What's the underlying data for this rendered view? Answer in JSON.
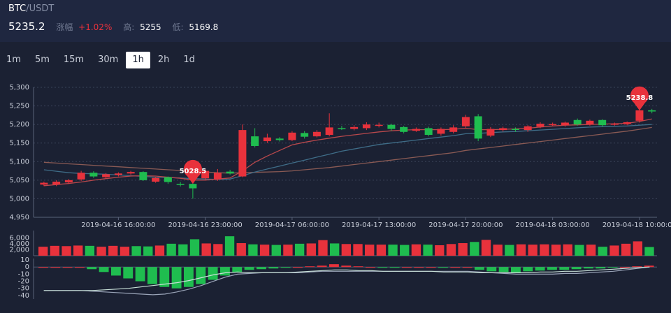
{
  "header": {
    "base": "BTC",
    "quote": "/USDT",
    "price": "5235.2",
    "change_label": "涨幅",
    "change_value": "+1.02%",
    "high_label": "高:",
    "high_value": "5255",
    "low_label": "低:",
    "low_value": "5169.8"
  },
  "tabs": [
    {
      "label": "1m",
      "active": false
    },
    {
      "label": "5m",
      "active": false
    },
    {
      "label": "15m",
      "active": false
    },
    {
      "label": "30m",
      "active": false
    },
    {
      "label": "1h",
      "active": true
    },
    {
      "label": "2h",
      "active": false
    },
    {
      "label": "1d",
      "active": false
    }
  ],
  "colors": {
    "up": "#e8323c",
    "down": "#1fbd4f",
    "ma1": "#b8484c",
    "ma2": "#3f6d88",
    "ma3": "#8a5a54",
    "grid": "#3a4258"
  },
  "chart_data": [
    {
      "type": "candlestick",
      "y_ticks": [
        "5,300",
        "5,250",
        "5,200",
        "5,150",
        "5,100",
        "5,050",
        "5,000",
        "4,950"
      ],
      "ylim": [
        4950,
        5300
      ],
      "x_ticks": [
        "2019-04-16 16:00:00",
        "2019-04-16 23:00:00",
        "2019-04-17 06:00:00",
        "2019-04-17 13:00:00",
        "2019-04-17 20:00:00",
        "2019-04-18 03:00:00",
        "2019-04-18 10:00:00"
      ],
      "x_tick_index": [
        6,
        13,
        20,
        27,
        34,
        41,
        48
      ],
      "candles": [
        {
          "o": 5038,
          "c": 5043,
          "h": 5046,
          "l": 5034
        },
        {
          "o": 5038,
          "c": 5046,
          "h": 5050,
          "l": 5034
        },
        {
          "o": 5044,
          "c": 5050,
          "h": 5053,
          "l": 5040
        },
        {
          "o": 5052,
          "c": 5070,
          "h": 5075,
          "l": 5048
        },
        {
          "o": 5070,
          "c": 5060,
          "h": 5074,
          "l": 5056
        },
        {
          "o": 5058,
          "c": 5066,
          "h": 5069,
          "l": 5054
        },
        {
          "o": 5064,
          "c": 5068,
          "h": 5071,
          "l": 5060
        },
        {
          "o": 5068,
          "c": 5072,
          "h": 5075,
          "l": 5065
        },
        {
          "o": 5072,
          "c": 5050,
          "h": 5074,
          "l": 5048
        },
        {
          "o": 5046,
          "c": 5056,
          "h": 5058,
          "l": 5043
        },
        {
          "o": 5058,
          "c": 5045,
          "h": 5060,
          "l": 5040
        },
        {
          "o": 5040,
          "c": 5038,
          "h": 5045,
          "l": 5033
        },
        {
          "o": 5040,
          "c": 5028,
          "h": 5060,
          "l": 5000
        },
        {
          "o": 5055,
          "c": 5075,
          "h": 5080,
          "l": 5050
        },
        {
          "o": 5052,
          "c": 5070,
          "h": 5080,
          "l": 5048
        },
        {
          "o": 5073,
          "c": 5068,
          "h": 5078,
          "l": 5065
        },
        {
          "o": 5060,
          "c": 5185,
          "h": 5200,
          "l": 5058
        },
        {
          "o": 5168,
          "c": 5142,
          "h": 5190,
          "l": 5138
        },
        {
          "o": 5155,
          "c": 5165,
          "h": 5175,
          "l": 5150
        },
        {
          "o": 5162,
          "c": 5158,
          "h": 5166,
          "l": 5154
        },
        {
          "o": 5158,
          "c": 5178,
          "h": 5182,
          "l": 5155
        },
        {
          "o": 5177,
          "c": 5167,
          "h": 5182,
          "l": 5162
        },
        {
          "o": 5168,
          "c": 5180,
          "h": 5185,
          "l": 5165
        },
        {
          "o": 5172,
          "c": 5192,
          "h": 5230,
          "l": 5168
        },
        {
          "o": 5190,
          "c": 5189,
          "h": 5196,
          "l": 5185
        },
        {
          "o": 5188,
          "c": 5193,
          "h": 5198,
          "l": 5184
        },
        {
          "o": 5190,
          "c": 5200,
          "h": 5206,
          "l": 5185
        },
        {
          "o": 5197,
          "c": 5199,
          "h": 5205,
          "l": 5192
        },
        {
          "o": 5199,
          "c": 5188,
          "h": 5202,
          "l": 5183
        },
        {
          "o": 5193,
          "c": 5180,
          "h": 5196,
          "l": 5176
        },
        {
          "o": 5183,
          "c": 5188,
          "h": 5192,
          "l": 5180
        },
        {
          "o": 5190,
          "c": 5172,
          "h": 5194,
          "l": 5168
        },
        {
          "o": 5175,
          "c": 5188,
          "h": 5192,
          "l": 5170
        },
        {
          "o": 5180,
          "c": 5192,
          "h": 5198,
          "l": 5176
        },
        {
          "o": 5195,
          "c": 5220,
          "h": 5226,
          "l": 5190
        },
        {
          "o": 5222,
          "c": 5162,
          "h": 5228,
          "l": 5155
        },
        {
          "o": 5170,
          "c": 5188,
          "h": 5193,
          "l": 5166
        },
        {
          "o": 5185,
          "c": 5190,
          "h": 5194,
          "l": 5181
        },
        {
          "o": 5188,
          "c": 5186,
          "h": 5192,
          "l": 5180
        },
        {
          "o": 5185,
          "c": 5195,
          "h": 5198,
          "l": 5180
        },
        {
          "o": 5194,
          "c": 5202,
          "h": 5206,
          "l": 5190
        },
        {
          "o": 5200,
          "c": 5201,
          "h": 5205,
          "l": 5196
        },
        {
          "o": 5198,
          "c": 5205,
          "h": 5208,
          "l": 5194
        },
        {
          "o": 5212,
          "c": 5200,
          "h": 5216,
          "l": 5197
        },
        {
          "o": 5200,
          "c": 5210,
          "h": 5213,
          "l": 5197
        },
        {
          "o": 5212,
          "c": 5198,
          "h": 5214,
          "l": 5194
        },
        {
          "o": 5200,
          "c": 5202,
          "h": 5205,
          "l": 5197
        },
        {
          "o": 5201,
          "c": 5206,
          "h": 5208,
          "l": 5198
        },
        {
          "o": 5210,
          "c": 5238,
          "h": 5255,
          "l": 5205
        },
        {
          "o": 5238,
          "c": 5235,
          "h": 5242,
          "l": 5230
        }
      ],
      "ma1": [
        5035,
        5038,
        5041,
        5045,
        5050,
        5054,
        5058,
        5061,
        5062,
        5061,
        5058,
        5055,
        5050,
        5050,
        5053,
        5056,
        5075,
        5098,
        5115,
        5130,
        5145,
        5152,
        5158,
        5163,
        5168,
        5172,
        5176,
        5180,
        5183,
        5185,
        5186,
        5186,
        5186,
        5187,
        5190,
        5186,
        5186,
        5187,
        5188,
        5190,
        5193,
        5196,
        5198,
        5199,
        5200,
        5201,
        5202,
        5203,
        5208,
        5215
      ],
      "ma2": [
        5078,
        5074,
        5070,
        5068,
        5067,
        5066,
        5064,
        5062,
        5060,
        5058,
        5057,
        5056,
        5054,
        5053,
        5052,
        5053,
        5062,
        5072,
        5080,
        5088,
        5096,
        5104,
        5112,
        5120,
        5128,
        5134,
        5140,
        5146,
        5150,
        5154,
        5158,
        5162,
        5166,
        5170,
        5175,
        5176,
        5178,
        5180,
        5181,
        5183,
        5185,
        5187,
        5189,
        5191,
        5193,
        5194,
        5195,
        5196,
        5198,
        5200
      ],
      "ma3": [
        5098,
        5096,
        5094,
        5092,
        5090,
        5088,
        5086,
        5084,
        5082,
        5080,
        5078,
        5076,
        5074,
        5072,
        5070,
        5069,
        5070,
        5071,
        5072,
        5073,
        5075,
        5078,
        5081,
        5084,
        5088,
        5092,
        5096,
        5100,
        5104,
        5108,
        5112,
        5116,
        5120,
        5124,
        5130,
        5134,
        5138,
        5142,
        5146,
        5150,
        5154,
        5158,
        5162,
        5166,
        5170,
        5174,
        5178,
        5182,
        5187,
        5192
      ],
      "labels": [
        {
          "index": 12,
          "text": "5028.5"
        },
        {
          "index": 48,
          "text": "5238.8"
        }
      ]
    },
    {
      "type": "bar",
      "y_ticks": [
        "6,000",
        "4,000",
        "2,000"
      ],
      "ylim": [
        0,
        7000
      ],
      "volumes": [
        3000,
        3300,
        3200,
        3400,
        3300,
        3000,
        3300,
        3000,
        3200,
        3100,
        3400,
        4000,
        3800,
        5500,
        4100,
        3900,
        6500,
        4200,
        3800,
        3700,
        3600,
        3700,
        4000,
        4100,
        5200,
        4100,
        3900,
        3900,
        3700,
        3700,
        3700,
        3600,
        3800,
        3700,
        3500,
        3900,
        4200,
        4600,
        5300,
        3700,
        3600,
        3800,
        3700,
        3800,
        3700,
        3800,
        3600,
        3700,
        3000,
        3400,
        4000,
        4800,
        2900
      ]
    },
    {
      "type": "bar",
      "y_ticks": [
        "10",
        "0",
        "-10",
        "-20",
        "-30",
        "-40"
      ],
      "ylim": [
        -45,
        12
      ],
      "hist": [
        0,
        0,
        0,
        0,
        -3,
        -7,
        -12,
        -16,
        -20,
        -24,
        -28,
        -30,
        -28,
        -24,
        -18,
        -12,
        -8,
        -4,
        -3,
        -2,
        -1,
        0,
        1,
        2,
        4,
        2,
        1,
        0,
        -1,
        -1,
        0,
        0,
        0,
        -1,
        0,
        0,
        -4,
        -6,
        -7,
        -8,
        -6,
        -5,
        -4,
        -4,
        -3,
        -2,
        -2,
        -1,
        0,
        1,
        2
      ],
      "line1": [
        -33,
        -33,
        -33,
        -33,
        -33,
        -32,
        -31,
        -30,
        -28,
        -26,
        -24,
        -22,
        -19,
        -15,
        -11,
        -8,
        -7,
        -8,
        -8,
        -8,
        -8,
        -7,
        -6,
        -5,
        -4,
        -4,
        -5,
        -5,
        -6,
        -6,
        -6,
        -6,
        -6,
        -7,
        -7,
        -7,
        -8,
        -8,
        -8,
        -8,
        -8,
        -7,
        -7,
        -6,
        -6,
        -5,
        -4,
        -3,
        -2,
        -1,
        0
      ],
      "line2": [
        -33,
        -33,
        -33,
        -33,
        -34,
        -35,
        -36,
        -37,
        -38,
        -39,
        -38,
        -35,
        -31,
        -26,
        -20,
        -14,
        -10,
        -9,
        -8,
        -8,
        -8,
        -8,
        -7,
        -6,
        -6,
        -6,
        -6,
        -6,
        -6,
        -6,
        -6,
        -6,
        -6,
        -6,
        -6,
        -6,
        -7,
        -8,
        -9,
        -10,
        -10,
        -10,
        -10,
        -9,
        -9,
        -8,
        -7,
        -6,
        -4,
        -2,
        0
      ]
    }
  ]
}
